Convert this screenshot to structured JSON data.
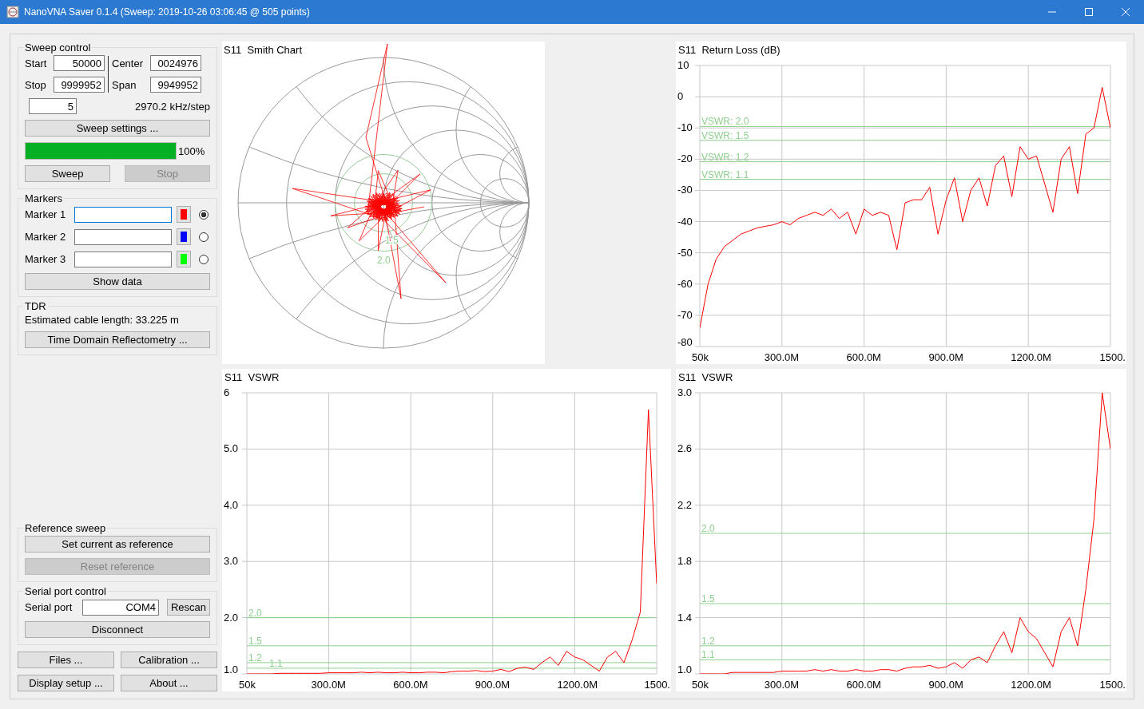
{
  "window": {
    "title": "NanoVNA Saver 0.1.4 (Sweep: 2019-10-26 03:06:45 @ 505 points)"
  },
  "sweep_control": {
    "title": "Sweep control",
    "fields": [
      {
        "label": "Start",
        "value": "50000"
      },
      {
        "label": "Center",
        "value": "0024976"
      },
      {
        "label": "Stop",
        "value": "9999952"
      },
      {
        "label": "Span",
        "value": "9949952"
      }
    ],
    "segments": "5",
    "step": "2970.2 kHz/step",
    "settings_button": "Sweep settings ...",
    "progress": {
      "level": 1.0,
      "text": "100%"
    },
    "buttons": [
      {
        "label": "Sweep",
        "disabled": false
      },
      {
        "label": "Stop",
        "disabled": true
      }
    ]
  },
  "markers": {
    "title": "Markers",
    "items": [
      {
        "label": "Marker 1",
        "value": "",
        "color": "#ff0000",
        "selected": true
      },
      {
        "label": "Marker 2",
        "value": "",
        "color": "#0000ff",
        "selected": false
      },
      {
        "label": "Marker 3",
        "value": "",
        "color": "#00ff00",
        "selected": false
      }
    ],
    "show_button": "Show data"
  },
  "tdr": {
    "title": "TDR",
    "text": "Estimated cable length: 33.225 m",
    "button": "Time Domain Reflectometry ..."
  },
  "reference_sweep": {
    "title": "Reference sweep",
    "buttons": [
      {
        "label": "Set current as reference",
        "disabled": false
      },
      {
        "label": "Reset reference",
        "disabled": true
      }
    ]
  },
  "serial_port": {
    "title": "Serial port control",
    "label": "Serial port",
    "value": "COM4",
    "rescan": "Rescan",
    "disconnect": "Disconnect"
  },
  "bottom_buttons": [
    "Files ...",
    "Calibration ...",
    "Display setup ...",
    "About ..."
  ],
  "smith_chart": {
    "title": "S11  Smith Chart",
    "circle_labels": [
      "1.5",
      "2.0"
    ]
  },
  "charts": [
    {
      "edge_label": "1500.",
      "chart_data": {
        "type": "line",
        "title": "S11  Return Loss (dB)",
        "grid": true,
        "x": [
          50000,
          30000000,
          60000000,
          90000000,
          120000000,
          150000000,
          180000000,
          210000000,
          240000000,
          270000000,
          300000000,
          330000000,
          360000000,
          390000000,
          420000000,
          450000000,
          480000000,
          510000000,
          540000000,
          570000000,
          600000000,
          630000000,
          660000000,
          690000000,
          720000000,
          750000000,
          780000000,
          810000000,
          840000000,
          870000000,
          900000000,
          930000000,
          960000000,
          990000000,
          1020000000,
          1050000000,
          1080000000,
          1110000000,
          1140000000,
          1170000000,
          1200000000,
          1230000000,
          1260000000,
          1290000000,
          1320000000,
          1350000000,
          1380000000,
          1410000000,
          1440000000,
          1470000000,
          1500000000
        ],
        "series": [
          {
            "color": "#ff0000",
            "values": [
              -74,
              -60,
              -52,
              -48,
              -46,
              -44,
              -43,
              -42,
              -41.5,
              -41,
              -40,
              -41,
              -39,
              -38,
              -37,
              -38,
              -36,
              -39,
              -37,
              -44,
              -36,
              -38,
              -37,
              -38,
              -49,
              -34,
              -33,
              -33,
              -29,
              -44,
              -33,
              -26,
              -40,
              -30,
              -26,
              -35,
              -22,
              -19,
              -32,
              -16,
              -20,
              -19,
              -28,
              -37,
              -20,
              -16,
              -31,
              -12,
              -10,
              3,
              -10
            ]
          }
        ],
        "xlim": [
          50000,
          1500000000
        ],
        "ylim": [
          -80,
          10
        ],
        "xticks": [
          {
            "value": 50000,
            "label": "50k"
          },
          {
            "value": 300000000,
            "label": "300.0M"
          },
          {
            "value": 600000000,
            "label": "600.0M"
          },
          {
            "value": 900000000,
            "label": "900.0M"
          },
          {
            "value": 1200000000,
            "label": "1200.0M"
          }
        ],
        "yticks": [
          -80,
          -70,
          -60,
          -50,
          -40,
          -30,
          -20,
          -10,
          0,
          10
        ],
        "ref_lines": [
          {
            "axis": "y",
            "value": -9.54,
            "color": "#8fcf8f"
          },
          {
            "axis": "y",
            "value": -13.98,
            "color": "#8fcf8f"
          },
          {
            "axis": "y",
            "value": -20.83,
            "color": "#8fcf8f"
          },
          {
            "axis": "y",
            "value": -26.44,
            "color": "#8fcf8f"
          }
        ],
        "annotations": [
          {
            "text": "VSWR: 2.0",
            "y": -9.54
          },
          {
            "text": "VSWR: 1.5",
            "y": -13.98
          },
          {
            "text": "VSWR: 1.2",
            "y": -20.83
          },
          {
            "text": "VSWR: 1.1",
            "y": -26.44
          }
        ]
      }
    },
    {
      "edge_label": "1500.",
      "chart_data": {
        "type": "line",
        "title": "S11  VSWR",
        "grid": true,
        "x": [
          50000,
          30000000,
          60000000,
          90000000,
          120000000,
          150000000,
          180000000,
          210000000,
          240000000,
          270000000,
          300000000,
          330000000,
          360000000,
          390000000,
          420000000,
          450000000,
          480000000,
          510000000,
          540000000,
          570000000,
          600000000,
          630000000,
          660000000,
          690000000,
          720000000,
          750000000,
          780000000,
          810000000,
          840000000,
          870000000,
          900000000,
          930000000,
          960000000,
          990000000,
          1020000000,
          1050000000,
          1080000000,
          1110000000,
          1140000000,
          1170000000,
          1200000000,
          1230000000,
          1260000000,
          1290000000,
          1320000000,
          1350000000,
          1380000000,
          1410000000,
          1440000000,
          1470000000,
          1500000000
        ],
        "series": [
          {
            "color": "#ff0000",
            "values": [
              1.0,
              1.0,
              1.0,
              1.0,
              1.01,
              1.01,
              1.01,
              1.01,
              1.01,
              1.01,
              1.02,
              1.02,
              1.02,
              1.02,
              1.03,
              1.02,
              1.03,
              1.02,
              1.02,
              1.03,
              1.02,
              1.02,
              1.03,
              1.03,
              1.02,
              1.04,
              1.05,
              1.05,
              1.06,
              1.04,
              1.05,
              1.08,
              1.04,
              1.1,
              1.12,
              1.08,
              1.2,
              1.3,
              1.15,
              1.4,
              1.3,
              1.25,
              1.15,
              1.05,
              1.3,
              1.4,
              1.2,
              1.6,
              2.1,
              5.7,
              2.6
            ]
          }
        ],
        "xlim": [
          50000,
          1500000000
        ],
        "ylim": [
          1,
          6
        ],
        "xticks": [
          {
            "value": 50000,
            "label": "50k"
          },
          {
            "value": 300000000,
            "label": "300.0M"
          },
          {
            "value": 600000000,
            "label": "600.0M"
          },
          {
            "value": 900000000,
            "label": "900.0M"
          },
          {
            "value": 1200000000,
            "label": "1200.0M"
          }
        ],
        "yticks": [
          {
            "value": 1,
            "label": "1.0"
          },
          {
            "value": 2,
            "label": "2.0"
          },
          {
            "value": 3,
            "label": "3.0"
          },
          {
            "value": 4,
            "label": "4.0"
          },
          {
            "value": 5,
            "label": "5.0"
          },
          {
            "value": 6,
            "label": "6"
          }
        ],
        "ref_lines": [
          {
            "axis": "y",
            "value": 2.0,
            "color": "#8fcf8f"
          },
          {
            "axis": "y",
            "value": 1.5,
            "color": "#8fcf8f"
          },
          {
            "axis": "y",
            "value": 1.2,
            "color": "#8fcf8f"
          },
          {
            "axis": "y",
            "value": 1.1,
            "color": "#8fcf8f"
          }
        ],
        "annotations": [
          {
            "text": "2.0",
            "y": 2.0
          },
          {
            "text": "1.5",
            "y": 1.5
          },
          {
            "text": "1.2",
            "y": 1.2
          },
          {
            "text": "1.1",
            "y": 1.1
          }
        ]
      }
    },
    {
      "edge_label": "1500.",
      "chart_data": {
        "type": "line",
        "title": "S11  VSWR",
        "grid": true,
        "x": [
          50000,
          30000000,
          60000000,
          90000000,
          120000000,
          150000000,
          180000000,
          210000000,
          240000000,
          270000000,
          300000000,
          330000000,
          360000000,
          390000000,
          420000000,
          450000000,
          480000000,
          510000000,
          540000000,
          570000000,
          600000000,
          630000000,
          660000000,
          690000000,
          720000000,
          750000000,
          780000000,
          810000000,
          840000000,
          870000000,
          900000000,
          930000000,
          960000000,
          990000000,
          1020000000,
          1050000000,
          1080000000,
          1110000000,
          1140000000,
          1170000000,
          1200000000,
          1230000000,
          1260000000,
          1290000000,
          1320000000,
          1350000000,
          1380000000,
          1410000000,
          1440000000,
          1470000000,
          1500000000
        ],
        "series": [
          {
            "color": "#ff0000",
            "values": [
              1.0,
              1.0,
              1.0,
              1.0,
              1.01,
              1.01,
              1.01,
              1.01,
              1.01,
              1.01,
              1.02,
              1.02,
              1.02,
              1.02,
              1.03,
              1.02,
              1.03,
              1.02,
              1.02,
              1.03,
              1.02,
              1.02,
              1.03,
              1.03,
              1.02,
              1.04,
              1.05,
              1.05,
              1.06,
              1.04,
              1.05,
              1.08,
              1.04,
              1.1,
              1.12,
              1.08,
              1.2,
              1.3,
              1.15,
              1.4,
              1.3,
              1.25,
              1.15,
              1.05,
              1.3,
              1.4,
              1.2,
              1.6,
              2.1,
              3.0,
              2.6
            ]
          }
        ],
        "xlim": [
          50000,
          1500000000
        ],
        "ylim": [
          1,
          3
        ],
        "xticks": [
          {
            "value": 50000,
            "label": "50k"
          },
          {
            "value": 300000000,
            "label": "300.0M"
          },
          {
            "value": 600000000,
            "label": "600.0M"
          },
          {
            "value": 900000000,
            "label": "900.0M"
          },
          {
            "value": 1200000000,
            "label": "1200.0M"
          }
        ],
        "yticks": [
          {
            "value": 1,
            "label": "1.0"
          },
          {
            "value": 1.4,
            "label": "1.4"
          },
          {
            "value": 1.8,
            "label": "1.8"
          },
          {
            "value": 2.2,
            "label": "2.2"
          },
          {
            "value": 2.6,
            "label": "2.6"
          },
          {
            "value": 3,
            "label": "3.0"
          }
        ],
        "ref_lines": [
          {
            "axis": "y",
            "value": 2.0,
            "color": "#8fcf8f"
          },
          {
            "axis": "y",
            "value": 1.5,
            "color": "#8fcf8f"
          },
          {
            "axis": "y",
            "value": 1.2,
            "color": "#8fcf8f"
          },
          {
            "axis": "y",
            "value": 1.1,
            "color": "#8fcf8f"
          }
        ],
        "annotations": [
          {
            "text": "2.0",
            "y": 2.0
          },
          {
            "text": "1.5",
            "y": 1.5
          },
          {
            "text": "1.2",
            "y": 1.2
          },
          {
            "text": "1.1",
            "y": 1.1
          }
        ]
      }
    }
  ]
}
